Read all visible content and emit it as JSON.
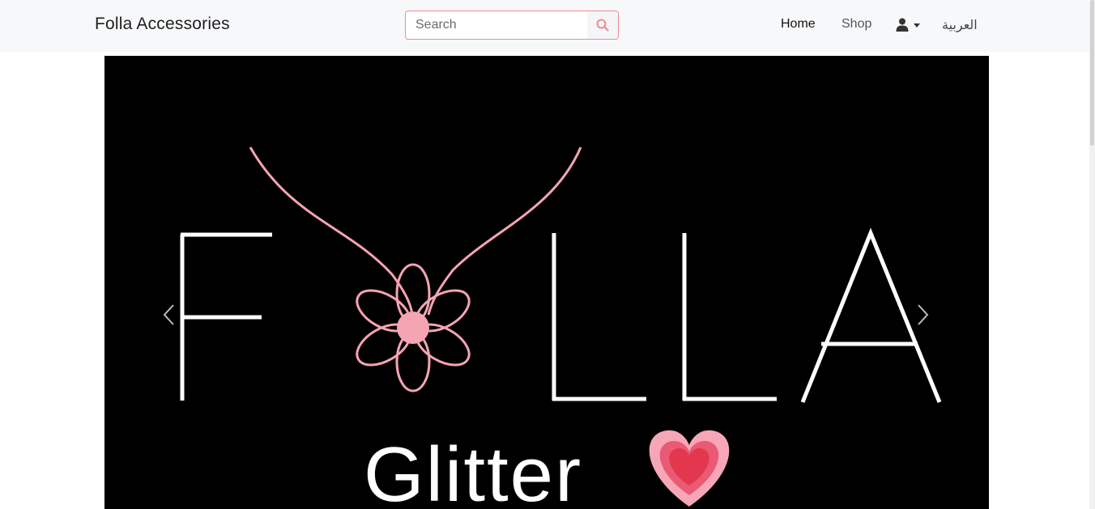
{
  "navbar": {
    "brand": "Folla Accessories",
    "search": {
      "placeholder": "Search",
      "value": "",
      "icon": "search-icon"
    },
    "links": {
      "home": "Home",
      "shop": "Shop",
      "language": "العربية"
    },
    "user_icon": "user-icon"
  },
  "carousel": {
    "slide_text": {
      "logo": "FOLLA",
      "tagline": "Glitter"
    },
    "prev_icon": "chevron-left-icon",
    "next_icon": "chevron-right-icon"
  },
  "colors": {
    "accent_pink": "#f08b93",
    "slide_background": "#000000",
    "flower_pink": "#f4a4b2",
    "heart_red": "#e3374f"
  }
}
